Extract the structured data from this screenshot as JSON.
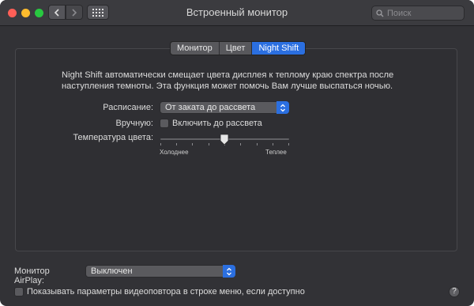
{
  "window": {
    "title": "Встроенный монитор",
    "search": {
      "placeholder": "Поиск",
      "icon": "search-icon"
    }
  },
  "tabs": [
    {
      "label": "Монитор",
      "active": false
    },
    {
      "label": "Цвет",
      "active": false
    },
    {
      "label": "Night Shift",
      "active": true
    }
  ],
  "night_shift": {
    "description": "Night Shift автоматически смещает цвета дисплея к теплому краю спектра после наступления темноты. Эта функция может помочь Вам лучше выспаться ночью.",
    "schedule_label": "Расписание:",
    "schedule_value": "От заката до рассвета",
    "manual_label": "Вручную:",
    "manual_checkbox_label": "Включить до рассвета",
    "manual_checked": false,
    "temperature_label": "Температура цвета:",
    "temperature_min_label": "Холоднее",
    "temperature_max_label": "Теплее",
    "temperature_value": 0.5
  },
  "airplay": {
    "label": "Монитор AirPlay:",
    "value": "Выключен"
  },
  "mirroring": {
    "checkbox_label": "Показывать параметры видеоповтора в строке меню, если доступно",
    "checked": false
  },
  "help": {
    "label": "?"
  },
  "colors": {
    "accent": "#2b6fe0",
    "background": "#323236"
  }
}
